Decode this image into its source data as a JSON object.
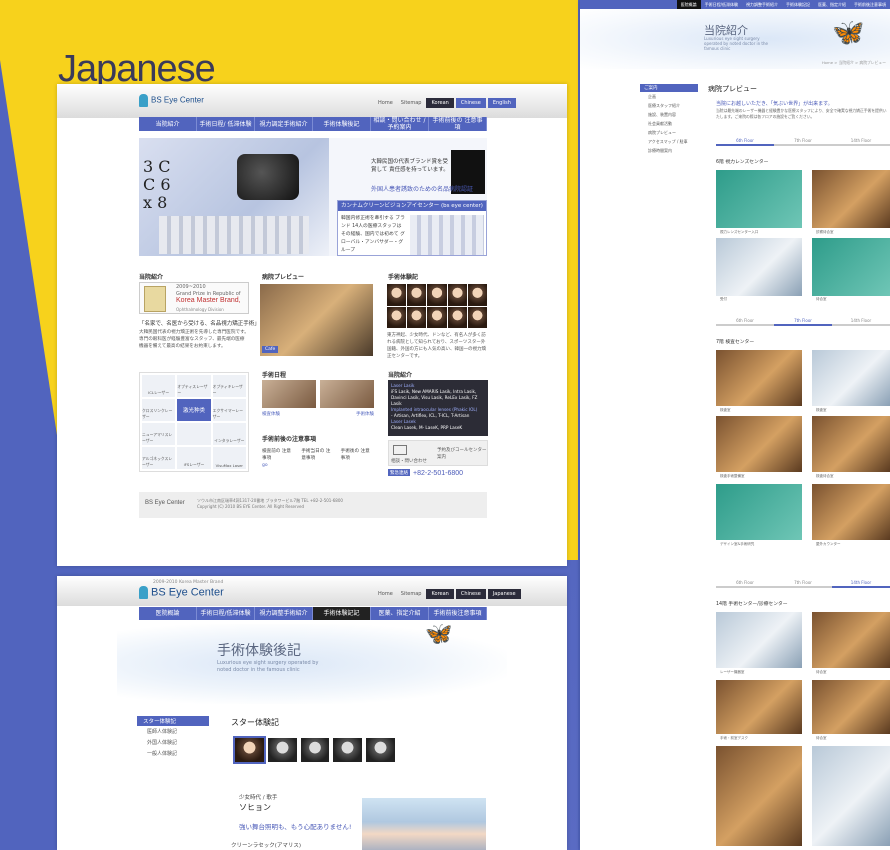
{
  "title": "Japanese",
  "colors": {
    "yellow": "#f7d21c",
    "blue": "#5164be",
    "dark": "#222222"
  },
  "page1": {
    "logo": "BS Eye Center",
    "toplinks": [
      "Home",
      "Sitemap"
    ],
    "langs": [
      "Korean",
      "Chinese",
      "English"
    ],
    "nav": [
      "当院紹介",
      "手術日程/ 低滞体験",
      "視力調定手術紹介",
      "手術体験後記",
      "相談・問い合わせ /予約案内",
      "手術前後の 注意事項"
    ],
    "hero": {
      "text1": "大韓民国の代表ブランド賞を受賞して 責任感を持っています。",
      "text2": "外国人患者誘致のための名品病院認証",
      "panel_title": "カンナムクリーンビジョンアイセンター (bs eye center)は",
      "panel_text": "韓国内修正術を牽引する ブランド 14人の医療スタッフは その経験、国内では初めて グローバル・アンバサダー・グループ"
    },
    "about": {
      "title": "当院紹介",
      "award_years": "2009~2010",
      "award_line1": "Grand Prize in Republic of",
      "award_brand": "Korea Master Brand,",
      "award_line3": "Ophthalmology Division",
      "head": "「名家で、名医から受ける、名品視力矯正手術」",
      "text": "大韓民国代表の視力矯正術を先導した専門医院です。専門の眼科医が経験豊富なスタッフ、最先端の医療機器を備えて最高の結果をお約束します。"
    },
    "preview": {
      "title": "病院プレビュー",
      "label": "Cafe"
    },
    "reviews": {
      "title": "手術体験記",
      "text": "東方神起、少女時代、ドンなど、有名人が多く訪れる病院として知られており、スポーツスター外国籍、外国の方にも人気の高い、韓国一の視力矯正センターです。"
    },
    "lasers": [
      "ICLレーザー",
      "オプティスレーザー",
      "オプティキレーザー",
      "クロスリンクレーザー",
      "",
      "エクサイマーレーザー",
      "ニューアマリスレーザー",
      "",
      "インタラレーザー",
      "アルゴネックスレーザー",
      "iFSレーザー",
      "VisuMax Laser"
    ],
    "laser_highlight": "激光种类",
    "schedule": {
      "title": "手術日程",
      "labels": [
        "検査体験",
        "手術体験"
      ]
    },
    "notes": {
      "title": "手術前後の注意事項",
      "items": [
        "検査前の 注意事項",
        "手術当日の 注意事項",
        "手術後の 注意事項"
      ],
      "go": "go"
    },
    "clinic": {
      "title": "当院紹介",
      "head1": "Laser Lasik",
      "line1": "iFS Lasik, New AMARIS Lasik, Intra Lasik, Davinci Lasik, Visu Lasik, ReLEx Lasik, FZ Lasik",
      "head2": "Implanted intraocular lenses (Phakic IOL)",
      "line2": "- Artisan, Artiflex, ICL, T-ICL, T-Artisan",
      "head3": "Laser Lasek",
      "line3": "Clean Lasek, M- LaseK, PRP LaseK"
    },
    "contact": {
      "label1": "相談・問い合わせ",
      "label2": "予約及びコールセンター案内"
    },
    "phone": {
      "tag": "緊急連絡",
      "number": "+82-2-501-6800"
    },
    "footer": {
      "logo": "BS Eye Center",
      "addr": "ソウル市江南区瑞草4洞1317-20番地 ブラタワービル7階 TEL +82-2-501-6800",
      "copy": "Copyright (C) 2010 BS EYE Center. All Right Reserved"
    }
  },
  "page2": {
    "brand_line": "2009-2010 Korea Master Brand",
    "logo": "BS Eye Center",
    "toplinks": [
      "Home",
      "Sitemap"
    ],
    "langs": [
      "Korean",
      "Chinese",
      "Japanese"
    ],
    "nav": [
      "医院概論",
      "手術日程/低滞体験",
      "視力調整手術紹介",
      "手術体験記記",
      "医薬、指定介紹",
      "手術前後注意事項"
    ],
    "banner_title": "手術体験後記",
    "banner_sub": "Luxurious eye sight surgery operated by noted doctor in the famous clinic",
    "subnav": {
      "head": "スター体験記",
      "items": [
        "医師人体験記",
        "外国人体験記",
        "一般人体験記"
      ]
    },
    "section_title": "スター体験記",
    "group": "少女時代 / 歌手",
    "name": "ソヒョン",
    "quote": "強い舞台照明も、もう心配ありません!",
    "procedure": "クリーンラセック(アマリス)"
  },
  "page3": {
    "topnav": [
      "医院概論",
      "手術日程/低滞体験",
      "視力調整手術紹介",
      "手術体験記記",
      "医薬、指定介紹",
      "手術前後注意事項"
    ],
    "banner_title": "当院紹介",
    "banner_sub": "Luxurious eye sight surgery operated by noted doctor in the famous clinic",
    "crumb": "Home > 当院紹介 > 病院プレビュー",
    "subnav": {
      "head": "ご案内",
      "items": [
        "企画",
        "医療スタッフ紹介",
        "施設、装置内容",
        "社会貢献活動",
        "病院プレビュー",
        "アクセスマップ / 駐車",
        "診療時間案内"
      ]
    },
    "heading": "病院プレビュー",
    "lead": "当院にお越しいただき、「気ぶい世界」が出来ます。",
    "leadtxt": "当院は最先端のレーザー機器と経験豊かな医療スタッフにより、安全で確実な視力矯正手術を提供いたします。ご来院の際は各フロアの施設をご覧ください。",
    "floors": [
      "6th Floor",
      "7th Floor",
      "14th Floor"
    ],
    "sec6": "6階 視力レンズセンター",
    "sec7": "7階 検査センター",
    "sec14": "14階 手術センター/診療センター",
    "labels6": [
      "視力レンズセンター入口",
      "診察待合室",
      "受付",
      "待合室"
    ],
    "labels7": [
      "検査室",
      "検査室",
      "検査手術整備室",
      "検査待合室",
      "デザイン室&手術研究",
      "屋外カウンター"
    ],
    "labels14": [
      "レーザー機器室",
      "待合室",
      "手術・前室デスク",
      "待合室"
    ]
  }
}
